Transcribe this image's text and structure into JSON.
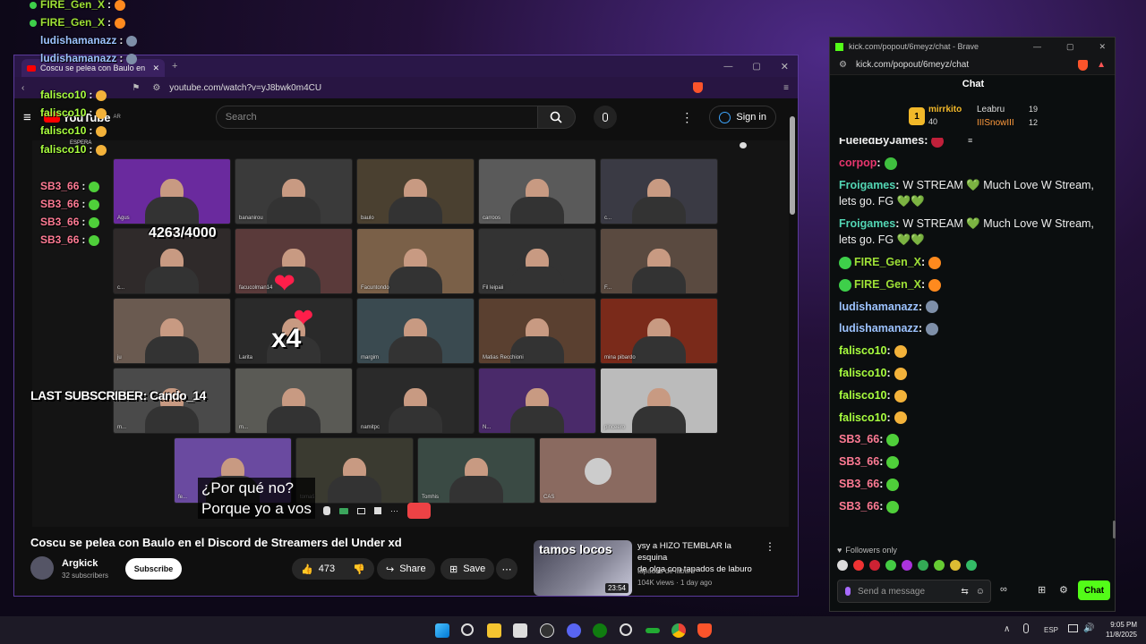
{
  "overlay_chat": [
    {
      "user": "FIRE_Gen_X",
      "color": "#9ee036",
      "emoji": "#ff8a1e"
    },
    {
      "user": "FIRE_Gen_X",
      "color": "#9ee036",
      "emoji": "#ff8a1e"
    },
    {
      "user": "ludishamanazz",
      "color": "#9dc3ff",
      "emoji": "#7e8fa8"
    },
    {
      "user": "ludishamanazz",
      "color": "#9dc3ff",
      "emoji": "#7e8fa8"
    },
    {
      "user": "falisco10",
      "color": "#a9ff3f",
      "emoji": "#f3b23a"
    },
    {
      "user": "falisco10",
      "color": "#a9ff3f",
      "emoji": "#f3b23a"
    },
    {
      "user": "falisco10",
      "color": "#a9ff3f",
      "emoji": "#f3b23a"
    },
    {
      "user": "falisco10",
      "color": "#a9ff3f",
      "emoji": "#f3b23a"
    },
    {
      "user": "SB3_66",
      "color": "#ff7b94",
      "emoji": "#4fcf3a"
    },
    {
      "user": "SB3_66",
      "color": "#ff7b94",
      "emoji": "#4fcf3a"
    },
    {
      "user": "SB3_66",
      "color": "#ff7b94",
      "emoji": "#4fcf3a"
    },
    {
      "user": "SB3_66",
      "color": "#ff7b94",
      "emoji": "#4fcf3a"
    }
  ],
  "overlay_sep": ":",
  "youtube": {
    "tab_title": "Coscu se pelea con Baulo en",
    "url": "youtube.com/watch?v=yJ8bwk0m4CU",
    "logo": "YouTube",
    "region": "AR",
    "search_placeholder": "Search",
    "sign_in": "Sign in",
    "espera_label": "ESPERA",
    "counter": "4263/4000",
    "multiplier": "x4",
    "last_sub": "LAST SUBSCRIBER: Cando_14",
    "subtitle_1": "¿Por qué no?",
    "subtitle_2": "Porque yo a vos",
    "tiles": [
      "Agus",
      "bananirou",
      "baulo",
      "carroos",
      "c...",
      "c...",
      "facucolman14",
      "Facuntondo",
      "Fil leipaii",
      "F...",
      "ju",
      "Larita",
      "margim",
      "Matias Recchioni",
      "mina pibardo",
      "m...",
      "m...",
      "namitpc",
      "N...",
      "pinceero",
      "fe...",
      "tomaš",
      "Tomhis",
      "CAS"
    ],
    "video_title": "Coscu se pelea con Baulo en el Discord de Streamers del Under xd",
    "channel": "Argkick",
    "subscribers": "32 subscribers",
    "subscribe": "Subscribe",
    "likes": "473",
    "share": "Share",
    "save": "Save",
    "rec_thumb_text": "tamos locos",
    "rec_duration": "23:54",
    "rec_title_1": "ysy a HIZO TEMBLAR la esquina",
    "rec_title_2": "de olga con tapados de laburo",
    "rec_channel": "tapados de laburo",
    "rec_meta": "104K views · 1 day ago"
  },
  "kick": {
    "window_title": "kick.com/popout/6meyz/chat - Brave",
    "url": "kick.com/popout/6meyz/chat",
    "header": "Chat",
    "leaders": [
      {
        "name": "mirrkito",
        "count": "40",
        "rank": "1"
      },
      {
        "name": "Leabru",
        "count": "19"
      },
      {
        "name": "IIISnowIII",
        "count": "12"
      }
    ],
    "messages": [
      {
        "user": "FueledByJames",
        "text": "",
        "color": "#f0f0f0",
        "emoji": "#c0203a"
      },
      {
        "user": "corpop",
        "text": "",
        "color": "#e8366e",
        "emoji": "#3fbf3f"
      },
      {
        "user": "Froigames",
        "text": "W STREAM 💚 Much Love W Stream,",
        "text2": "lets go. FG 💚💚",
        "color": "#53d6b4"
      },
      {
        "user": "Froigames",
        "text": "W STREAM 💚 Much Love W Stream,",
        "text2": "lets go. FG 💚💚",
        "color": "#53d6b4"
      },
      {
        "user": "FIRE_Gen_X",
        "text": "",
        "color": "#9ee036",
        "emoji": "#ff8a1e",
        "badge": true
      },
      {
        "user": "FIRE_Gen_X",
        "text": "",
        "color": "#9ee036",
        "emoji": "#ff8a1e",
        "badge": true
      },
      {
        "user": "ludishamanazz",
        "text": "",
        "color": "#9dc3ff",
        "emoji": "#7e8fa8"
      },
      {
        "user": "ludishamanazz",
        "text": "",
        "color": "#9dc3ff",
        "emoji": "#7e8fa8"
      },
      {
        "user": "falisco10",
        "text": "",
        "color": "#a9ff3f",
        "emoji": "#f3b23a"
      },
      {
        "user": "falisco10",
        "text": "",
        "color": "#a9ff3f",
        "emoji": "#f3b23a"
      },
      {
        "user": "falisco10",
        "text": "",
        "color": "#a9ff3f",
        "emoji": "#f3b23a"
      },
      {
        "user": "falisco10",
        "text": "",
        "color": "#a9ff3f",
        "emoji": "#f3b23a"
      },
      {
        "user": "SB3_66",
        "text": "",
        "color": "#ff7b94",
        "emoji": "#4fcf3a"
      },
      {
        "user": "SB3_66",
        "text": "",
        "color": "#ff7b94",
        "emoji": "#4fcf3a"
      },
      {
        "user": "SB3_66",
        "text": "",
        "color": "#ff7b94",
        "emoji": "#4fcf3a"
      },
      {
        "user": "SB3_66",
        "text": "",
        "color": "#ff7b94",
        "emoji": "#4fcf3a"
      }
    ],
    "followers_only": "Followers only",
    "send_placeholder": "Send a message",
    "chat_button": "Chat",
    "accent": "#53fc18"
  },
  "taskbar": {
    "lang": "ESP",
    "time": "9:05 PM",
    "date": "11/8/2025"
  }
}
